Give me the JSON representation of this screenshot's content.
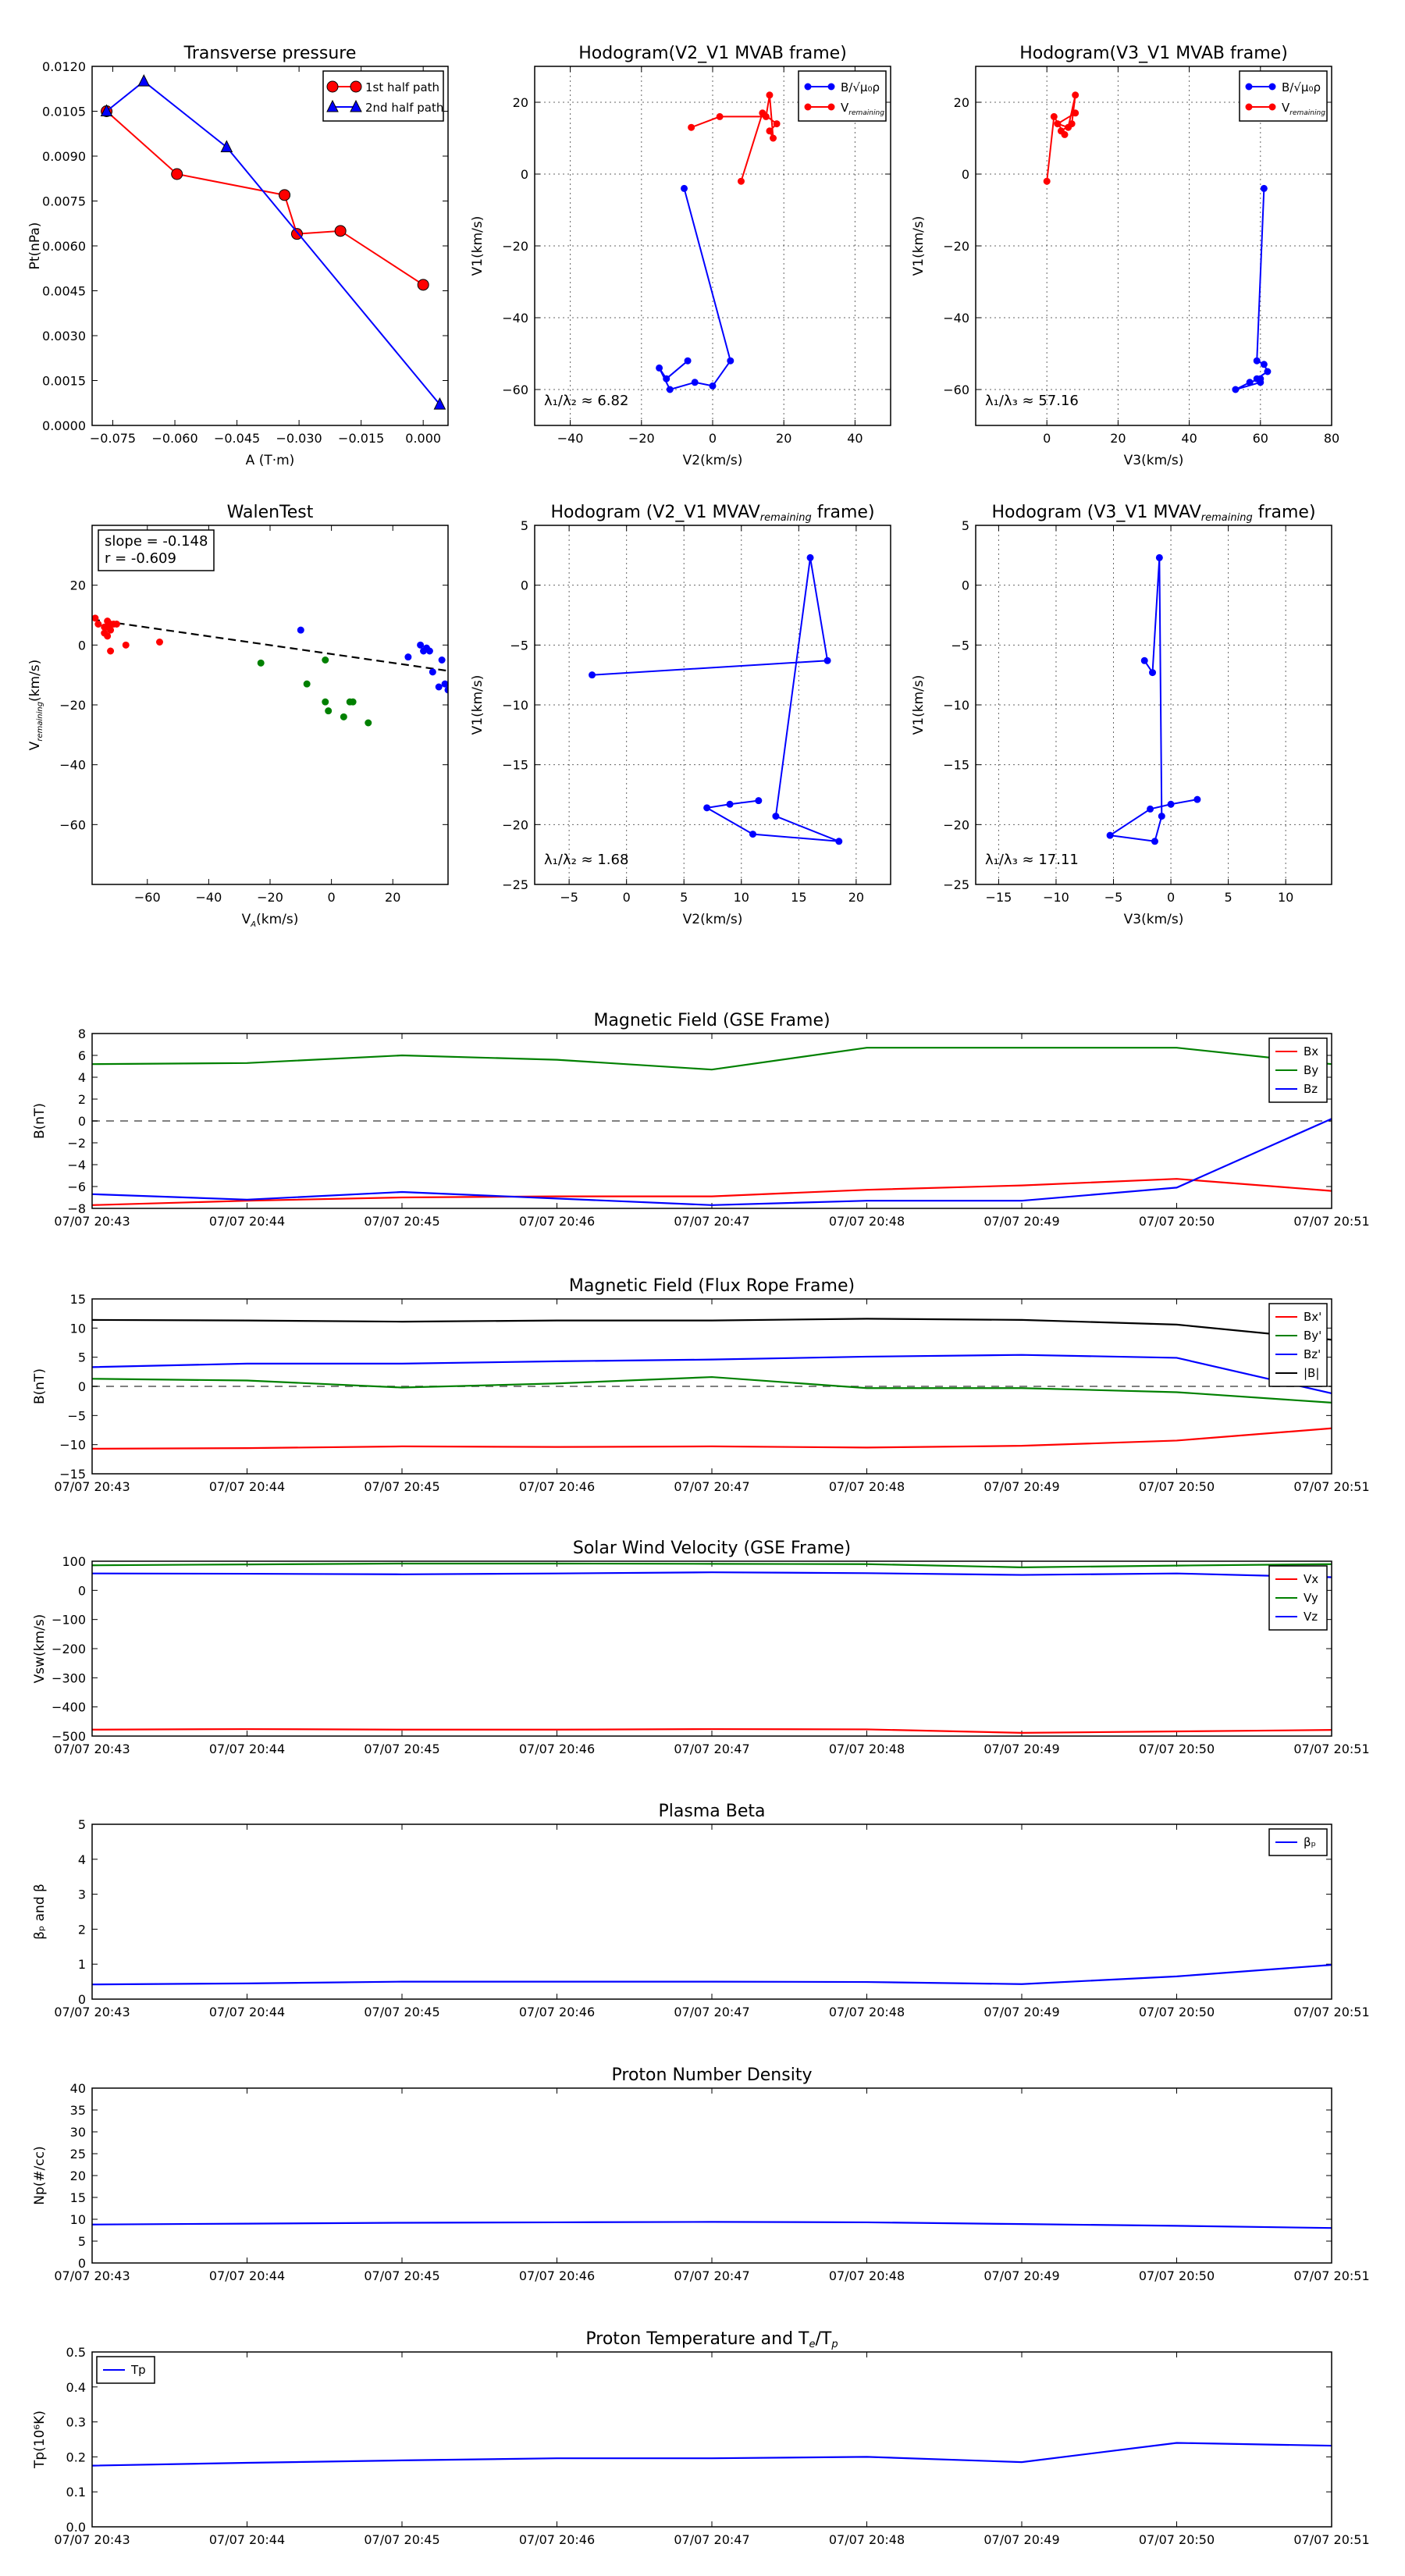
{
  "chart_data": [
    {
      "id": "pt",
      "type": "line",
      "title": "Transverse pressure",
      "xlabel": "A (T·m)",
      "ylabel": "Pt(nPa)",
      "xlim": [
        -0.08,
        0.006
      ],
      "ylim": [
        0.0,
        0.012
      ],
      "xticks": [
        -0.075,
        -0.06,
        -0.045,
        -0.03,
        -0.015,
        0.0
      ],
      "xtick_labels": [
        "−0.075",
        "−0.060",
        "−0.045",
        "−0.030",
        "−0.015",
        "0.000"
      ],
      "yticks": [
        0.0,
        0.0015,
        0.003,
        0.0045,
        0.006,
        0.0075,
        0.009,
        0.0105,
        0.012
      ],
      "ytick_labels": [
        "0.0000",
        "0.0015",
        "0.0030",
        "0.0045",
        "0.0060",
        "0.0075",
        "0.0090",
        "0.0105",
        "0.0120"
      ],
      "grid": false,
      "legend": "top-right",
      "series": [
        {
          "name": "1st half path",
          "color": "#ff0000",
          "marker": "circle",
          "x": [
            -0.0765,
            -0.0595,
            -0.0335,
            -0.0305,
            -0.02,
            0.0
          ],
          "y": [
            0.0105,
            0.0084,
            0.0077,
            0.0064,
            0.0065,
            0.0047
          ]
        },
        {
          "name": "2nd half path",
          "color": "#0000ff",
          "marker": "triangle",
          "x": [
            -0.0765,
            -0.0675,
            -0.0475,
            0.004
          ],
          "y": [
            0.0105,
            0.0115,
            0.0093,
            0.0007
          ]
        }
      ]
    },
    {
      "id": "hodo12",
      "type": "line",
      "title": "Hodogram(V2_V1 MVAB frame)",
      "xlabel": "V2(km/s)",
      "ylabel": "V1(km/s)",
      "xlim": [
        -50,
        50
      ],
      "ylim": [
        -70,
        30
      ],
      "xticks": [
        -40,
        -20,
        0,
        20,
        40
      ],
      "xtick_labels": [
        "−40",
        "−20",
        "0",
        "20",
        "40"
      ],
      "yticks": [
        -60,
        -40,
        -20,
        0,
        20
      ],
      "ytick_labels": [
        "−60",
        "−40",
        "−20",
        "0",
        "20"
      ],
      "grid": true,
      "legend": "top-right",
      "annotation": "λ₁/λ₂ ≈ 6.82",
      "series": [
        {
          "name": "B/√μ₀ρ",
          "color": "#0000ff",
          "marker": "dot",
          "x": [
            -8,
            5,
            0,
            -5,
            -12,
            -15,
            -13,
            -7
          ],
          "y": [
            -4,
            -52,
            -59,
            -58,
            -60,
            -54,
            -57,
            -52
          ]
        },
        {
          "name": "V",
          "name_sub": "remaining",
          "color": "#ff0000",
          "marker": "dot",
          "x": [
            -6,
            2,
            15,
            16,
            17,
            16,
            18,
            14,
            8
          ],
          "y": [
            13,
            16,
            16,
            22,
            10,
            12,
            14,
            17,
            -2
          ]
        }
      ]
    },
    {
      "id": "hodo13",
      "type": "line",
      "title": "Hodogram(V3_V1 MVAB frame)",
      "xlabel": "V3(km/s)",
      "ylabel": "V1(km/s)",
      "xlim": [
        -20,
        80
      ],
      "ylim": [
        -70,
        30
      ],
      "xticks": [
        0,
        20,
        40,
        60,
        80
      ],
      "xtick_labels": [
        "0",
        "20",
        "40",
        "60",
        "80"
      ],
      "yticks": [
        -60,
        -40,
        -20,
        0,
        20
      ],
      "ytick_labels": [
        "−60",
        "−40",
        "−20",
        "0",
        "20"
      ],
      "grid": true,
      "legend": "top-right",
      "annotation": "λ₁/λ₃ ≈ 57.16",
      "series": [
        {
          "name": "B/√μ₀ρ",
          "color": "#0000ff",
          "marker": "dot",
          "x": [
            61,
            59,
            61,
            62,
            59,
            60,
            53,
            57,
            60
          ],
          "y": [
            -4,
            -52,
            -53,
            -55,
            -57,
            -58,
            -60,
            -58,
            -57
          ]
        },
        {
          "name": "V",
          "name_sub": "remaining",
          "color": "#ff0000",
          "marker": "dot",
          "x": [
            0,
            2,
            5,
            4,
            7,
            8,
            6,
            3,
            8
          ],
          "y": [
            -2,
            16,
            11,
            12,
            14,
            22,
            13,
            14,
            17
          ]
        }
      ]
    },
    {
      "id": "walen",
      "type": "scatter",
      "title": "WalenTest",
      "xlabel": "V",
      "xlabel_sub": "A",
      "xlabel_tail": "(km/s)",
      "ylabel": "V",
      "ylabel_sub": "remaining",
      "ylabel_tail": "(km/s)",
      "xlim": [
        -78,
        38
      ],
      "ylim": [
        -80,
        40
      ],
      "xticks": [
        -60,
        -40,
        -20,
        0,
        20
      ],
      "xtick_labels": [
        "−60",
        "−40",
        "−20",
        "0",
        "20"
      ],
      "yticks": [
        -60,
        -40,
        -20,
        0,
        20
      ],
      "ytick_labels": [
        "−60",
        "−40",
        "−20",
        "0",
        "20"
      ],
      "grid": false,
      "annotation_lines": [
        "slope = -0.148",
        "r = -0.609"
      ],
      "fit": {
        "slope": -0.148,
        "intercept": -3.0
      },
      "series": [
        {
          "color": "#ff0000",
          "x": [
            -77,
            -76,
            -74,
            -73,
            -72,
            -72,
            -71,
            -70,
            -74,
            -73,
            -72,
            -67,
            -56,
            -73
          ],
          "y": [
            9,
            7,
            6,
            6,
            5,
            7,
            7,
            7,
            4,
            3,
            -2,
            0,
            1,
            8
          ]
        },
        {
          "color": "#008000",
          "x": [
            -23,
            -2,
            -8,
            -2,
            -1,
            4,
            6,
            7,
            12
          ],
          "y": [
            -6,
            -5,
            -13,
            -19,
            -22,
            -24,
            -19,
            -19,
            -26
          ]
        },
        {
          "color": "#0000ff",
          "x": [
            -10,
            25,
            29,
            30,
            31,
            32,
            33,
            36,
            37,
            35,
            38
          ],
          "y": [
            5,
            -4,
            0,
            -2,
            -1,
            -2,
            -9,
            -5,
            -13,
            -14,
            -15
          ]
        }
      ]
    },
    {
      "id": "hodo22",
      "type": "line",
      "title": "Hodogram (V2_V1 MVAV",
      "title_sub": "remaining",
      "title_tail": " frame)",
      "xlabel": "V2(km/s)",
      "ylabel": "V1(km/s)",
      "xlim": [
        -8,
        23
      ],
      "ylim": [
        -25,
        5
      ],
      "xticks": [
        -5,
        0,
        5,
        10,
        15,
        20
      ],
      "xtick_labels": [
        "−5",
        "0",
        "5",
        "10",
        "15",
        "20"
      ],
      "yticks": [
        -25,
        -20,
        -15,
        -10,
        -5,
        0,
        5
      ],
      "ytick_labels": [
        "−25",
        "−20",
        "−15",
        "−10",
        "−5",
        "0",
        "5"
      ],
      "grid": true,
      "annotation": "λ₁/λ₂ ≈ 1.68",
      "series": [
        {
          "color": "#0000ff",
          "marker": "dot",
          "x": [
            -3,
            17.5,
            16,
            13,
            18.5,
            11,
            7,
            9,
            11.5
          ],
          "y": [
            -7.5,
            -6.3,
            2.3,
            -19.3,
            -21.4,
            -20.8,
            -18.6,
            -18.3,
            -18
          ]
        }
      ]
    },
    {
      "id": "hodo23",
      "type": "line",
      "title": "Hodogram (V3_V1 MVAV",
      "title_sub": "remaining",
      "title_tail": " frame)",
      "xlabel": "V3(km/s)",
      "ylabel": "V1(km/s)",
      "xlim": [
        -17,
        14
      ],
      "ylim": [
        -25,
        5
      ],
      "xticks": [
        -15,
        -10,
        -5,
        0,
        5,
        10
      ],
      "xtick_labels": [
        "−15",
        "−10",
        "−5",
        "0",
        "5",
        "10"
      ],
      "yticks": [
        -25,
        -20,
        -15,
        -10,
        -5,
        0,
        5
      ],
      "ytick_labels": [
        "−25",
        "−20",
        "−15",
        "−10",
        "−5",
        "0",
        "5"
      ],
      "grid": true,
      "annotation": "λ₁/λ₃ ≈ 17.11",
      "series": [
        {
          "color": "#0000ff",
          "marker": "dot",
          "x": [
            -2.3,
            -1.6,
            -1,
            -0.8,
            -1.4,
            -5.3,
            -1.8,
            0,
            2.3
          ],
          "y": [
            -6.3,
            -7.3,
            2.3,
            -19.3,
            -21.4,
            -20.9,
            -18.7,
            -18.3,
            -17.9
          ]
        }
      ]
    },
    {
      "id": "bgse",
      "type": "line",
      "title": "Magnetic Field (GSE Frame)",
      "ylabel": "B(nT)",
      "x": [
        "07/07 20:43",
        "07/07 20:44",
        "07/07 20:45",
        "07/07 20:46",
        "07/07 20:47",
        "07/07 20:48",
        "07/07 20:49",
        "07/07 20:50",
        "07/07 20:51"
      ],
      "ylim": [
        -8,
        8
      ],
      "yticks": [
        -8,
        -6,
        -4,
        -2,
        0,
        2,
        4,
        6,
        8
      ],
      "ytick_labels": [
        "−8",
        "−6",
        "−4",
        "−2",
        "0",
        "2",
        "4",
        "6",
        "8"
      ],
      "zero_line": true,
      "legend": "top-right",
      "series": [
        {
          "name": "Bx",
          "color": "#ff0000",
          "values": [
            -7.7,
            -7.3,
            -7.0,
            -6.9,
            -6.9,
            -6.3,
            -5.9,
            -5.3,
            -6.4
          ]
        },
        {
          "name": "By",
          "color": "#008000",
          "values": [
            5.2,
            5.3,
            6.0,
            5.6,
            4.7,
            6.7,
            6.7,
            6.7,
            5.2
          ]
        },
        {
          "name": "Bz",
          "color": "#0000ff",
          "values": [
            -6.7,
            -7.2,
            -6.5,
            -7.1,
            -7.7,
            -7.3,
            -7.3,
            -6.1,
            0.2
          ]
        }
      ]
    },
    {
      "id": "bfr",
      "type": "line",
      "title": "Magnetic Field (Flux Rope Frame)",
      "ylabel": "B(nT)",
      "x": [
        "07/07 20:43",
        "07/07 20:44",
        "07/07 20:45",
        "07/07 20:46",
        "07/07 20:47",
        "07/07 20:48",
        "07/07 20:49",
        "07/07 20:50",
        "07/07 20:51"
      ],
      "ylim": [
        -15,
        15
      ],
      "yticks": [
        -15,
        -10,
        -5,
        0,
        5,
        10,
        15
      ],
      "ytick_labels": [
        "−15",
        "−10",
        "−5",
        "0",
        "5",
        "10",
        "15"
      ],
      "zero_line": true,
      "legend": "top-right",
      "series": [
        {
          "name": "Bx'",
          "color": "#ff0000",
          "values": [
            -10.7,
            -10.6,
            -10.3,
            -10.4,
            -10.3,
            -10.5,
            -10.2,
            -9.3,
            -7.2
          ]
        },
        {
          "name": "By'",
          "color": "#008000",
          "values": [
            1.3,
            1.0,
            -0.2,
            0.5,
            1.6,
            -0.3,
            -0.3,
            -1.0,
            -2.8
          ]
        },
        {
          "name": "Bz'",
          "color": "#0000ff",
          "values": [
            3.3,
            3.9,
            3.9,
            4.3,
            4.6,
            5.1,
            5.4,
            4.9,
            -1.2
          ]
        },
        {
          "name": "|B|",
          "color": "#000000",
          "values": [
            11.4,
            11.3,
            11.1,
            11.3,
            11.3,
            11.6,
            11.4,
            10.6,
            8.0
          ]
        }
      ]
    },
    {
      "id": "vsw",
      "type": "line",
      "title": "Solar Wind Velocity (GSE Frame)",
      "ylabel": "Vsw(km/s)",
      "x": [
        "07/07 20:43",
        "07/07 20:44",
        "07/07 20:45",
        "07/07 20:46",
        "07/07 20:47",
        "07/07 20:48",
        "07/07 20:49",
        "07/07 20:50",
        "07/07 20:51"
      ],
      "ylim": [
        -500,
        100
      ],
      "yticks": [
        -500,
        -400,
        -300,
        -200,
        -100,
        0,
        100
      ],
      "ytick_labels": [
        "−500",
        "−400",
        "−300",
        "−200",
        "−100",
        "0",
        "100"
      ],
      "zero_line": false,
      "legend": "top-right",
      "series": [
        {
          "name": "Vx",
          "color": "#ff0000",
          "values": [
            -478,
            -476,
            -478,
            -478,
            -476,
            -477,
            -489,
            -484,
            -479
          ]
        },
        {
          "name": "Vy",
          "color": "#008000",
          "values": [
            86,
            89,
            92,
            92,
            91,
            90,
            79,
            85,
            90
          ]
        },
        {
          "name": "Vz",
          "color": "#0000ff",
          "values": [
            58,
            57,
            55,
            58,
            62,
            59,
            53,
            58,
            45
          ]
        }
      ]
    },
    {
      "id": "beta",
      "type": "line",
      "title": "Plasma Beta",
      "ylabel": "βₚ and β",
      "x": [
        "07/07 20:43",
        "07/07 20:44",
        "07/07 20:45",
        "07/07 20:46",
        "07/07 20:47",
        "07/07 20:48",
        "07/07 20:49",
        "07/07 20:50",
        "07/07 20:51"
      ],
      "ylim": [
        0,
        5
      ],
      "yticks": [
        0,
        1,
        2,
        3,
        4,
        5
      ],
      "ytick_labels": [
        "0",
        "1",
        "2",
        "3",
        "4",
        "5"
      ],
      "legend": "top-right",
      "series": [
        {
          "name": "βₚ",
          "color": "#0000ff",
          "values": [
            0.42,
            0.45,
            0.5,
            0.5,
            0.5,
            0.49,
            0.43,
            0.65,
            0.98
          ]
        }
      ]
    },
    {
      "id": "np",
      "type": "line",
      "title": "Proton Number Density",
      "ylabel": "Np(#/cc)",
      "x": [
        "07/07 20:43",
        "07/07 20:44",
        "07/07 20:45",
        "07/07 20:46",
        "07/07 20:47",
        "07/07 20:48",
        "07/07 20:49",
        "07/07 20:50",
        "07/07 20:51"
      ],
      "ylim": [
        0,
        40
      ],
      "yticks": [
        0,
        5,
        10,
        15,
        20,
        25,
        30,
        35,
        40
      ],
      "ytick_labels": [
        "0",
        "5",
        "10",
        "15",
        "20",
        "25",
        "30",
        "35",
        "40"
      ],
      "series": [
        {
          "color": "#0000ff",
          "values": [
            8.8,
            9.0,
            9.2,
            9.3,
            9.4,
            9.3,
            8.9,
            8.5,
            8.0
          ]
        }
      ]
    },
    {
      "id": "tp",
      "type": "line",
      "title": "Proton Temperature and T",
      "title_sub": "e",
      "title_tail": "/T",
      "title_sub2": "p",
      "ylabel": "Tp(10⁶K)",
      "x": [
        "07/07 20:43",
        "07/07 20:44",
        "07/07 20:45",
        "07/07 20:46",
        "07/07 20:47",
        "07/07 20:48",
        "07/07 20:49",
        "07/07 20:50",
        "07/07 20:51"
      ],
      "ylim": [
        0,
        0.5
      ],
      "yticks": [
        0,
        0.1,
        0.2,
        0.3,
        0.4,
        0.5
      ],
      "ytick_labels": [
        "0.0",
        "0.1",
        "0.2",
        "0.3",
        "0.4",
        "0.5"
      ],
      "legend": "top-left",
      "series": [
        {
          "name": "Tp",
          "color": "#0000ff",
          "values": [
            0.175,
            0.183,
            0.19,
            0.196,
            0.196,
            0.2,
            0.185,
            0.24,
            0.232
          ]
        }
      ]
    }
  ]
}
